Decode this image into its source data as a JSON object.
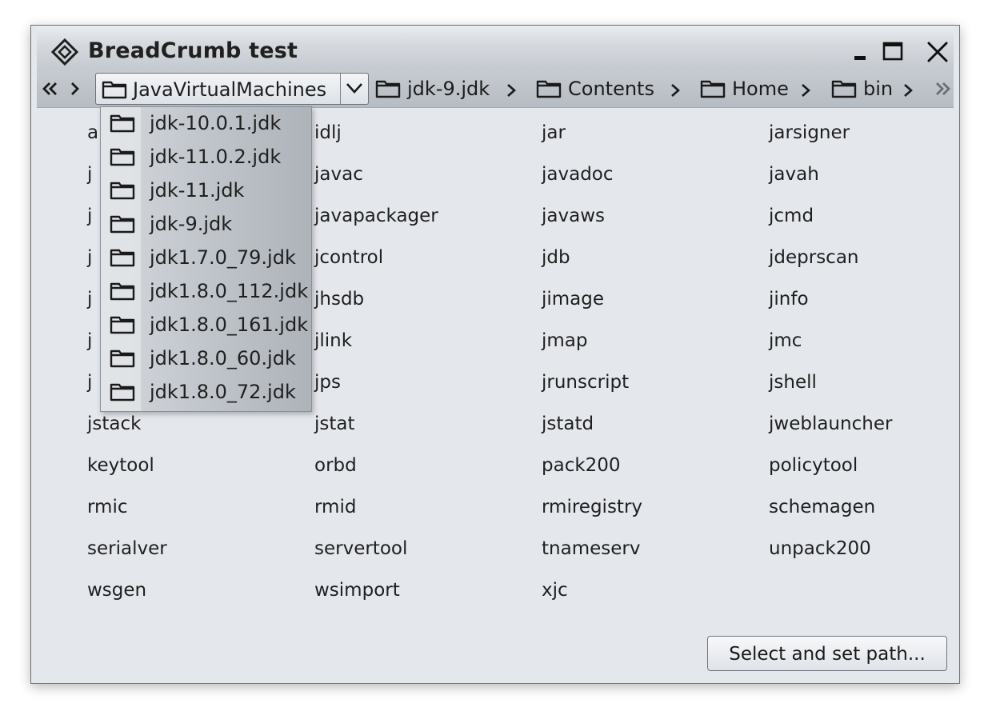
{
  "window": {
    "title": "BreadCrumb test"
  },
  "breadcrumb": {
    "combo_label": "JavaVirtualMachines",
    "crumbs": [
      "jdk-9.jdk",
      "Contents",
      "Home",
      "bin"
    ]
  },
  "popup": {
    "items": [
      "jdk-10.0.1.jdk",
      "jdk-11.0.2.jdk",
      "jdk-11.jdk",
      "jdk-9.jdk",
      "jdk1.7.0_79.jdk",
      "jdk1.8.0_112.jdk",
      "jdk1.8.0_161.jdk",
      "jdk1.8.0_60.jdk",
      "jdk1.8.0_72.jdk"
    ]
  },
  "files": {
    "col1": [
      "a",
      "j",
      "j",
      "j",
      "j",
      "j",
      "j",
      "jstack",
      "keytool",
      "rmic",
      "serialver",
      "wsgen"
    ],
    "col2": [
      "idlj",
      "javac",
      "javapackager",
      "jcontrol",
      "jhsdb",
      "jlink",
      "jps",
      "jstat",
      "orbd",
      "rmid",
      "servertool",
      "wsimport"
    ],
    "col3": [
      "jar",
      "javadoc",
      "javaws",
      "jdb",
      "jimage",
      "jmap",
      "jrunscript",
      "jstatd",
      "pack200",
      "rmiregistry",
      "tnameserv",
      "xjc"
    ],
    "col4": [
      "jarsigner",
      "javah",
      "jcmd",
      "jdeprscan",
      "jinfo",
      "jmc",
      "jshell",
      "jweblauncher",
      "policytool",
      "schemagen",
      "unpack200"
    ]
  },
  "actions": {
    "select_path": "Select and set path..."
  },
  "icons": {
    "app": "diamond-logo-icon",
    "minimize": "minimize-icon",
    "maximize": "maximize-icon",
    "close": "close-icon",
    "back": "double-chevron-left-icon",
    "forward": "chevron-right-icon",
    "overflow": "double-chevron-right-icon",
    "folder": "folder-icon"
  }
}
